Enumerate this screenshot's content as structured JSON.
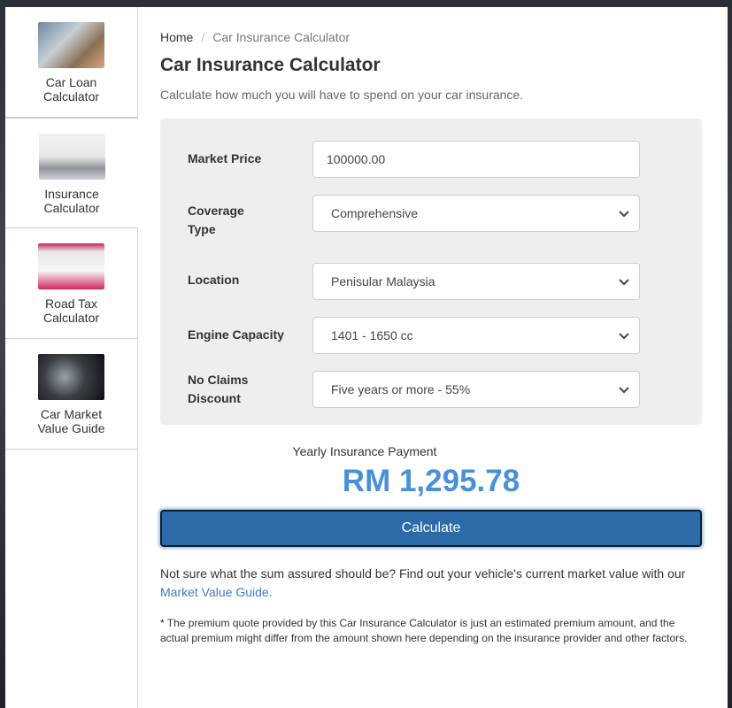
{
  "sidebar": {
    "items": [
      {
        "label": "Car Loan\nCalculator",
        "icon": "calculator-image"
      },
      {
        "label": "Insurance\nCalculator",
        "icon": "insured-car-image"
      },
      {
        "label": "Road Tax\nCalculator",
        "icon": "road-tax-disc-image"
      },
      {
        "label": "Car Market\nValue Guide",
        "icon": "car-headlight-image"
      }
    ]
  },
  "breadcrumb": {
    "home": "Home",
    "separator": "/",
    "current": "Car Insurance Calculator"
  },
  "page": {
    "title": "Car Insurance Calculator",
    "subtitle": "Calculate how much you will have to spend on your car insurance."
  },
  "form": {
    "market_price": {
      "label": "Market Price",
      "value": "100000.00"
    },
    "coverage_type": {
      "label": "Coverage\nType",
      "value": "Comprehensive"
    },
    "location": {
      "label": "Location",
      "value": "Penisular Malaysia"
    },
    "engine_capacity": {
      "label": "Engine Capacity",
      "value": "1401 - 1650 cc"
    },
    "ncd": {
      "label": "No Claims\nDiscount",
      "value": "Five years or more - 55%"
    }
  },
  "result": {
    "label": "Yearly Insurance Payment",
    "value": "RM 1,295.78"
  },
  "calculate_label": "Calculate",
  "note": {
    "text": "Not sure what the sum assured should be? Find out your vehicle's current market value with our ",
    "link": "Market Value Guide."
  },
  "disclaimer": "* The premium quote provided by this Car Insurance Calculator is just an estimated premium amount, and the actual premium might differ from the amount shown here depending on the insurance provider and other factors.",
  "colors": {
    "accent": "#2d6aa8",
    "result": "#4a90d9",
    "panel": "#eeeeee"
  }
}
